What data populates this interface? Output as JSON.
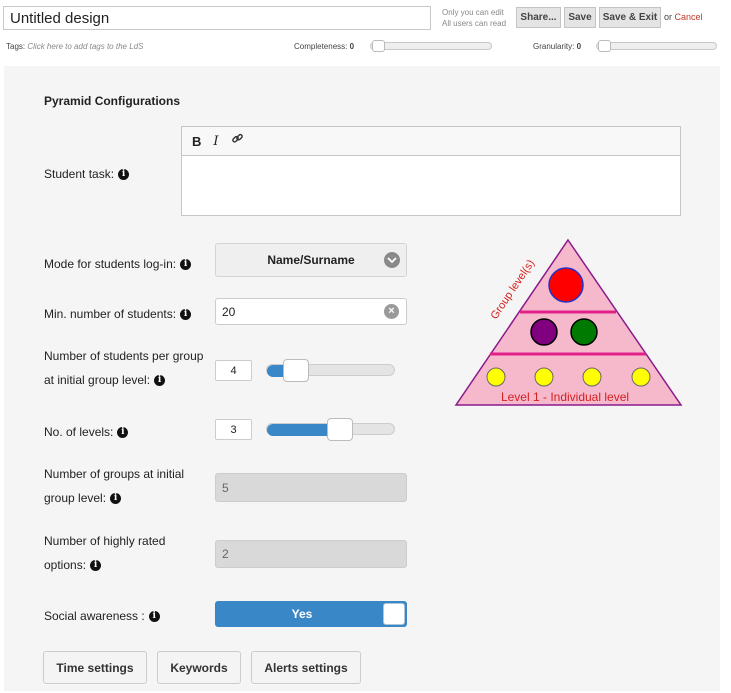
{
  "header": {
    "title_value": "Untitled design",
    "permissions_line1": "Only you can edit",
    "permissions_line2": "All users can read",
    "share_label": "Share...",
    "save_label": "Save",
    "save_exit_label": "Save & Exit",
    "or_text": "or",
    "cancel_label": "Cancel"
  },
  "meta": {
    "tags_label": "Tags:",
    "tags_placeholder": "Click here to add tags to the LdS",
    "completeness_label": "Completeness:",
    "completeness_value": "0",
    "granularity_label": "Granularity:",
    "granularity_value": "0"
  },
  "panel": {
    "heading": "Pyramid Configurations",
    "student_task_label": "Student task:",
    "editor_toolbar": {
      "bold": "B",
      "italic": "I",
      "link": "link-icon"
    },
    "mode_label": "Mode for students log-in:",
    "mode_value": "Name/Surname",
    "min_students_label": "Min. number of students:",
    "min_students_value": "20",
    "students_per_group_label_1": "Number of students per group",
    "students_per_group_label_2": "at initial group level:",
    "students_per_group_value": "4",
    "students_per_group_slider": {
      "value": 4,
      "fill_fraction": 0.16
    },
    "levels_label": "No. of levels:",
    "levels_value": "3",
    "levels_slider": {
      "value": 3,
      "fill_fraction": 0.5
    },
    "groups_label_1": "Number of groups at initial",
    "groups_label_2": "group level:",
    "groups_value": "5",
    "highly_rated_label_1": "Number of highly rated",
    "highly_rated_label_2": "options:",
    "highly_rated_value": "2",
    "social_label": "Social awareness :",
    "social_value": "Yes",
    "time_settings_label": "Time settings",
    "keywords_label": "Keywords",
    "alerts_settings_label": "Alerts settings"
  },
  "pyramid": {
    "group_levels_label": "Group level(s)",
    "individual_level_label": "Level 1 - Individual level",
    "colors": {
      "fill": "#f6b9cc",
      "outline": "#8b1a8b",
      "divider": "#e0218a",
      "text": "#d42020",
      "top": "#ff0000",
      "purple": "#800080",
      "green": "#007a00",
      "yellow": "#ffff00"
    }
  },
  "colors": {
    "accent": "#3a87c8",
    "cancel": "#c0392b"
  }
}
